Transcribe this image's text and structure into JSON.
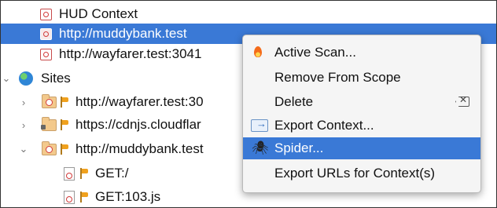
{
  "tree": {
    "contexts": [
      {
        "label": "HUD Context"
      },
      {
        "label": "http://muddybank.test",
        "selected": true
      },
      {
        "label": "http://wayfarer.test:3041"
      }
    ],
    "sites_label": "Sites",
    "sites": [
      {
        "label": "http://wayfarer.test:30",
        "expanded": false
      },
      {
        "label": "https://cdnjs.cloudflar",
        "expanded": false
      },
      {
        "label": "http://muddybank.test",
        "expanded": true
      }
    ],
    "requests": [
      {
        "label": "GET:/"
      },
      {
        "label": "GET:103.js"
      }
    ]
  },
  "context_menu": {
    "items": [
      {
        "label": "Active Scan...",
        "icon": "flame-icon"
      },
      {
        "label": "Remove From Scope",
        "icon": ""
      },
      {
        "label": "Delete",
        "icon": "",
        "shortcut_icon": "delete-key-icon"
      },
      {
        "label": "Export Context...",
        "icon": "export-icon"
      },
      {
        "label": "Spider...",
        "icon": "spider-icon",
        "selected": true
      },
      {
        "label": "Export URLs for Context(s)",
        "icon": ""
      }
    ]
  },
  "colors": {
    "selection": "#3a79d6",
    "menu_bg": "#f5f5f5",
    "context_icon_red": "#d23a3a"
  }
}
